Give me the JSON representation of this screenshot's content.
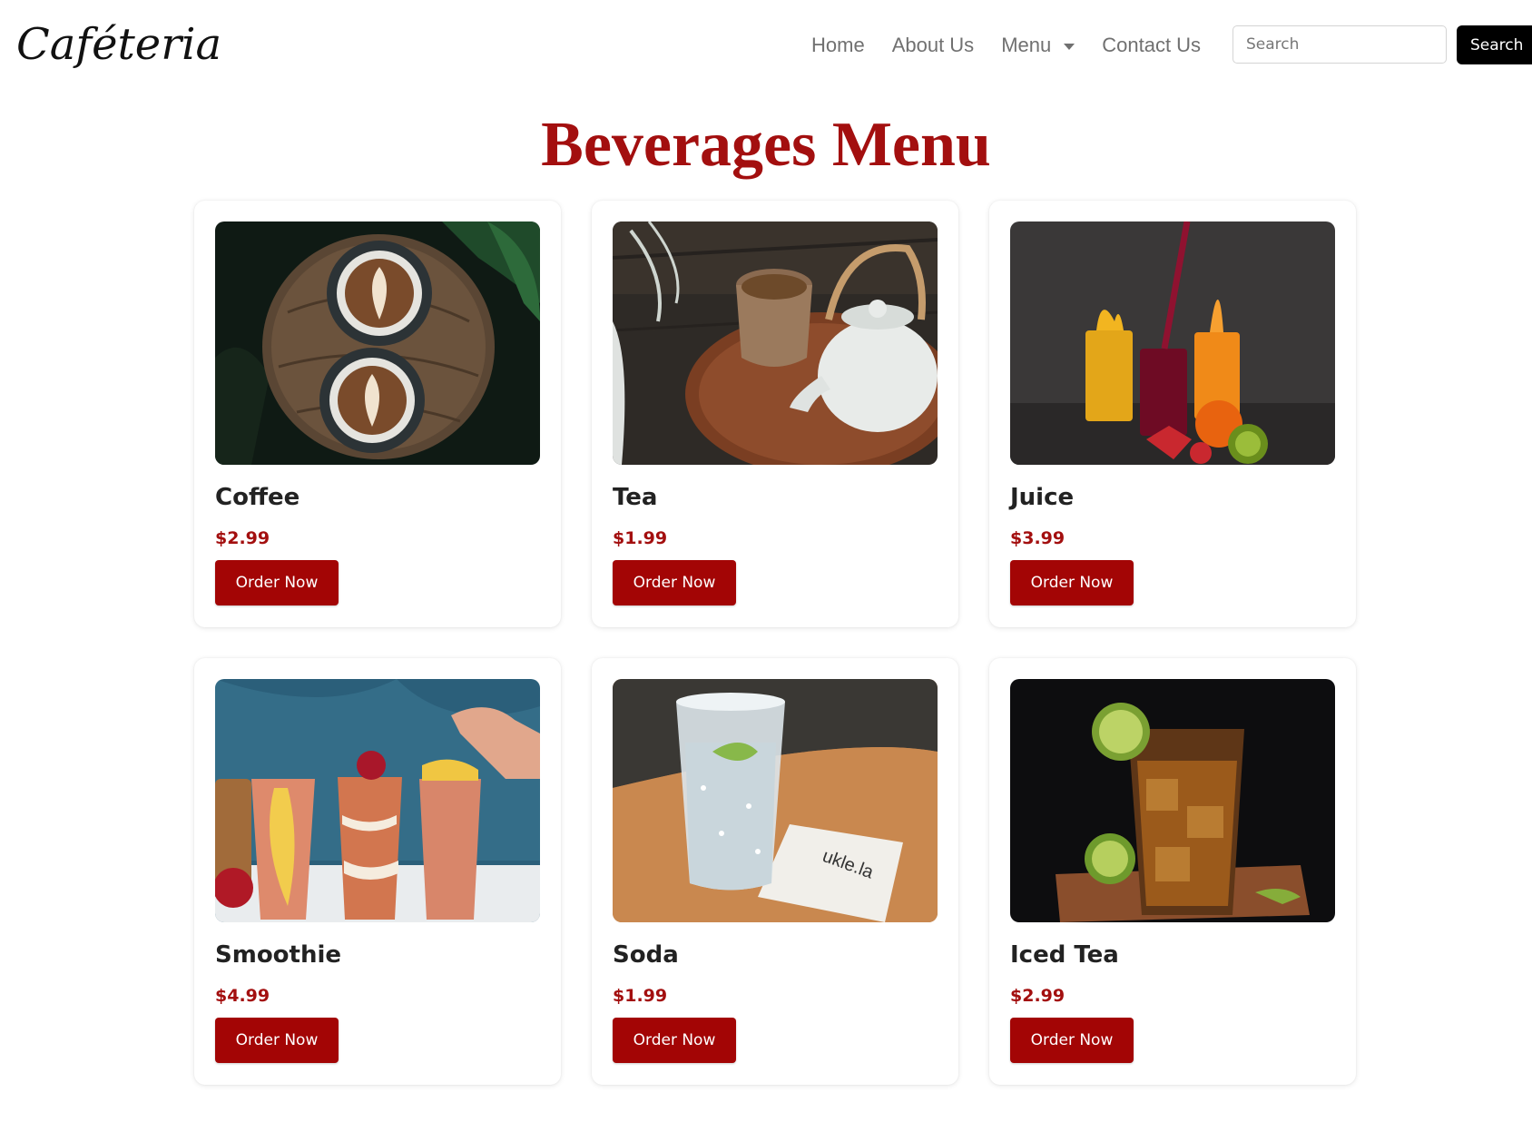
{
  "navbar": {
    "brand": "Caféteria",
    "links": [
      "Home",
      "About Us",
      "Menu",
      "Contact Us"
    ],
    "search_placeholder": "Search",
    "search_button": "Search"
  },
  "page_title": "Beverages Menu",
  "colors": {
    "accent": "#a30f0f",
    "button": "#a30505",
    "nav_text": "#707070",
    "search_button_bg": "#000000"
  },
  "items": [
    {
      "name": "Coffee",
      "price": "$2.99",
      "button": "Order Now",
      "image": "coffee-latte-art-photo"
    },
    {
      "name": "Tea",
      "price": "$1.99",
      "button": "Order Now",
      "image": "tea-pot-and-cup-photo"
    },
    {
      "name": "Juice",
      "price": "$3.99",
      "button": "Order Now",
      "image": "fruit-juice-glasses-photo"
    },
    {
      "name": "Smoothie",
      "price": "$4.99",
      "button": "Order Now",
      "image": "smoothie-glasses-photo"
    },
    {
      "name": "Soda",
      "price": "$1.99",
      "button": "Order Now",
      "image": "soda-water-glass-photo"
    },
    {
      "name": "Iced Tea",
      "price": "$2.99",
      "button": "Order Now",
      "image": "iced-tea-glass-photo"
    }
  ]
}
